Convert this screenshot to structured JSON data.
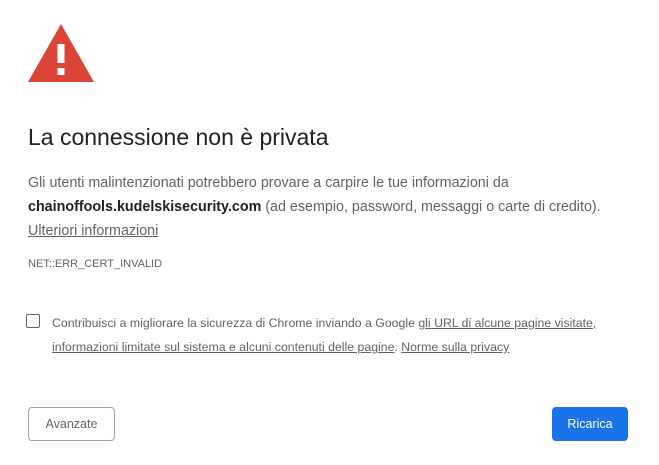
{
  "interstitial": {
    "title": "La connessione non è privata",
    "message_prefix": "Gli utenti malintenzionati potrebbero provare a carpire le tue informazioni da ",
    "hostname": "chainoffools.kudelskisecurity.com",
    "message_suffix": " (ad esempio, password, messaggi o carte di credito).",
    "learn_more_label": "Ulteriori informazioni",
    "error_code": "NET::ERR_CERT_INVALID",
    "icon": "warning-triangle-icon",
    "colors": {
      "warning_icon": "#db4437",
      "primary_button": "#1a73e8"
    }
  },
  "optin": {
    "checked": false,
    "text_prefix": "Contribuisci a migliorare la sicurezza di Chrome inviando a Google ",
    "link_label": "gli URL di alcune pagine visitate, informazioni limitate sul sistema e alcuni contenuti delle pagine",
    "separator": ". ",
    "privacy_label": "Norme sulla privacy"
  },
  "buttons": {
    "advanced_label": "Avanzate",
    "reload_label": "Ricarica"
  }
}
